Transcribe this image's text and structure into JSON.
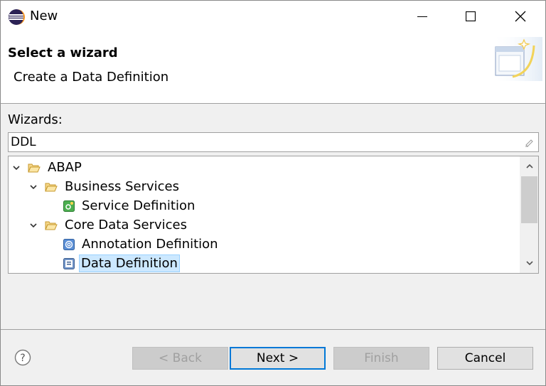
{
  "window": {
    "title": "New",
    "icon": "eclipse-icon",
    "controls": {
      "minimize": "minimize-icon",
      "maximize": "maximize-icon",
      "close": "close-icon"
    }
  },
  "header": {
    "title": "Select a wizard",
    "description": "Create a Data Definition",
    "banner_icon": "new-wizard-banner-icon"
  },
  "wizards": {
    "label": "Wizards:",
    "filter_value": "DDL",
    "clear_icon": "clear-filter-icon"
  },
  "tree": {
    "items": [
      {
        "label": "ABAP",
        "level": 0,
        "type": "folder",
        "expanded": true
      },
      {
        "label": "Business Services",
        "level": 1,
        "type": "folder",
        "expanded": true
      },
      {
        "label": "Service Definition",
        "level": 2,
        "type": "service-definition",
        "icon": "service-definition-icon"
      },
      {
        "label": "Core Data Services",
        "level": 1,
        "type": "folder",
        "expanded": true
      },
      {
        "label": "Annotation Definition",
        "level": 2,
        "type": "annotation-definition",
        "icon": "annotation-definition-icon"
      },
      {
        "label": "Data Definition",
        "level": 2,
        "type": "data-definition",
        "icon": "data-definition-icon",
        "selected": true
      }
    ]
  },
  "footer": {
    "help_icon": "help-icon",
    "back_label": "< Back",
    "next_label": "Next >",
    "finish_label": "Finish",
    "cancel_label": "Cancel"
  },
  "colors": {
    "selection_bg": "#cce8ff",
    "default_button_border": "#0078d7",
    "folder": "#e8b64a"
  }
}
